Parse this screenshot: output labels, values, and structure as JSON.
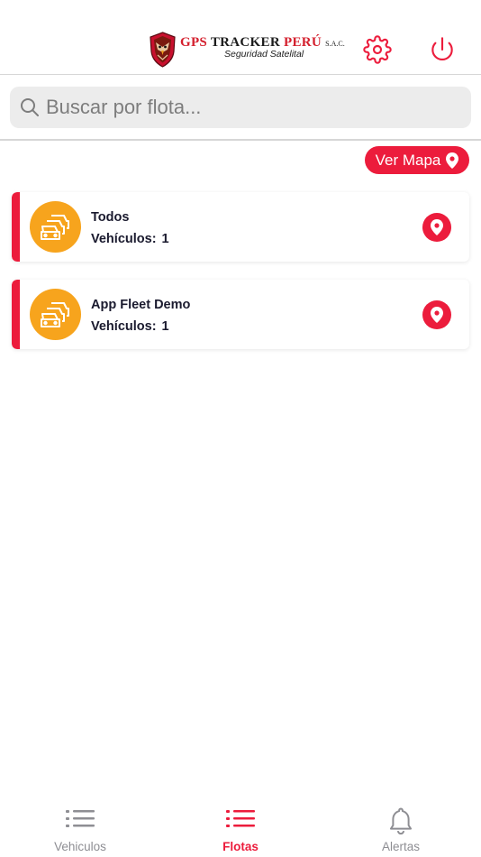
{
  "header": {
    "logo": {
      "brand_gps": "GPS",
      "brand_tracker": "TRACKER",
      "brand_peru": "PERÚ",
      "brand_suffix": "S.A.C.",
      "tagline": "Seguridad Satelital"
    },
    "settings_icon": "gear-icon",
    "power_icon": "power-icon"
  },
  "search": {
    "placeholder": "Buscar por flota...",
    "value": ""
  },
  "map_button": {
    "label": "Ver Mapa",
    "icon": "location-pin-icon"
  },
  "fleets": [
    {
      "name": "Todos",
      "vehicles_label": "Vehículos:",
      "vehicles_count": "1"
    },
    {
      "name": "App Fleet Demo",
      "vehicles_label": "Vehículos:",
      "vehicles_count": "1"
    }
  ],
  "tabs": [
    {
      "label": "Vehiculos",
      "icon": "list-icon",
      "active": false
    },
    {
      "label": "Flotas",
      "icon": "list-icon",
      "active": true
    },
    {
      "label": "Alertas",
      "icon": "bell-icon",
      "active": false
    }
  ],
  "colors": {
    "accent": "#ec1c3c",
    "fleet_avatar": "#f7a41d",
    "inactive_tab": "#8e8e93"
  }
}
